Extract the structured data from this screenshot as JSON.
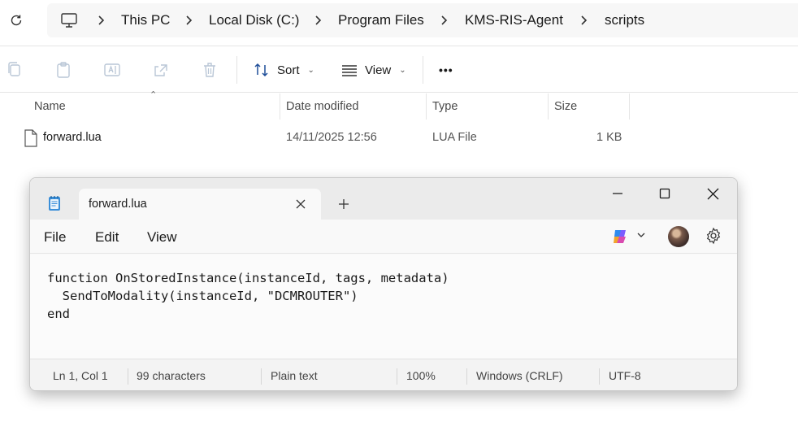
{
  "explorer": {
    "breadcrumb": [
      "This PC",
      "Local Disk (C:)",
      "Program Files",
      "KMS-RIS-Agent",
      "scripts"
    ],
    "toolbar": {
      "sort_label": "Sort",
      "view_label": "View",
      "more_label": "•••"
    },
    "columns": {
      "name": "Name",
      "date_modified": "Date modified",
      "type": "Type",
      "size": "Size"
    },
    "files": [
      {
        "name": "forward.lua",
        "date_modified": "14/11/2025 12:56",
        "type": "LUA File",
        "size": "1 KB"
      }
    ]
  },
  "notepad": {
    "tab_title": "forward.lua",
    "new_tab_symbol": "+",
    "menu": {
      "file": "File",
      "edit": "Edit",
      "view": "View"
    },
    "code": [
      "function OnStoredInstance(instanceId, tags, metadata)",
      "  SendToModality(instanceId, \"DCMROUTER\")",
      "end"
    ],
    "status": {
      "position": "Ln 1, Col 1",
      "characters": "99 characters",
      "format": "Plain text",
      "zoom": "100%",
      "line_endings": "Windows (CRLF)",
      "encoding": "UTF-8"
    }
  },
  "colors": {
    "titlebar": "#ebebeb",
    "copilot_accent": "#7b5cff",
    "text": "#1a1a1a"
  }
}
